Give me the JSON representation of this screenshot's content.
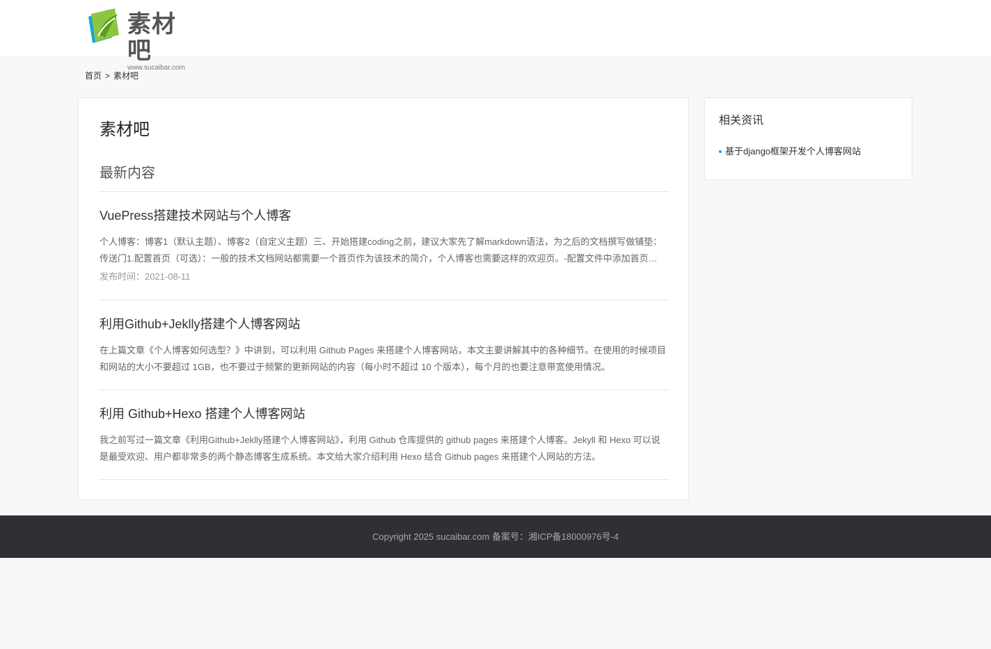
{
  "brand": {
    "name": "素材吧",
    "url_text": "www.sucaibar.com",
    "colors": {
      "leaf_green": "#8cc63f",
      "leaf_dark": "#5a9e1c",
      "accent_blue": "#1e9fff"
    }
  },
  "breadcrumb": {
    "home": "首页",
    "separator": ">",
    "current": "素材吧"
  },
  "main": {
    "title": "素材吧",
    "section_title": "最新内容",
    "articles": [
      {
        "title": "VuePress搭建技术网站与个人博客",
        "summary": "个人博客：博客1（默认主题）、博客2（自定义主题）三、开始搭建coding之前，建议大家先了解markdown语法，为之后的文档撰写做铺垫：传送门1.配置首页（可选）：一般的技术文档网站都需要一个首页作为该技术的简介，个人博客也需要这样的欢迎页。-配置文件中添加首页设置",
        "date": "发布时间：2021-08-11"
      },
      {
        "title": "利用Github+Jeklly搭建个人博客网站",
        "summary": "在上篇文章《个人博客如何选型？》中讲到，可以利用 Github Pages 来搭建个人博客网站，本文主要讲解其中的各种细节。在使用的时候项目和网站的大小不要超过 1GB，也不要过于频繁的更新网站的内容（每小时不超过 10 个版本），每个月的也要注意带宽使用情况。"
      },
      {
        "title": "利用 Github+Hexo 搭建个人博客网站",
        "summary": "我之前写过一篇文章《利用Github+Jeklly搭建个人博客网站》，利用 Github 仓库提供的 github pages 来搭建个人博客。Jekyll 和 Hexo 可以说是最受欢迎、用户都非常多的两个静态博客生成系统。本文给大家介绍利用 Hexo 结合 Github pages 来搭建个人网站的方法。"
      }
    ]
  },
  "sidebar": {
    "title": "相关资讯",
    "items": [
      {
        "label": "基于django框架开发个人博客网站"
      }
    ]
  },
  "footer": {
    "text": "Copyright 2025 sucaibar.com 备案号：湘ICP备18000976号-4"
  }
}
